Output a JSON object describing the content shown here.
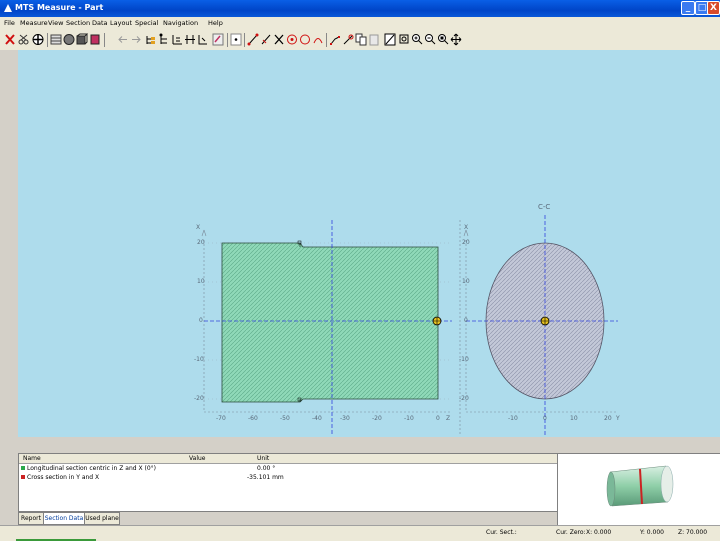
{
  "window": {
    "title": "MTS Measure - Part",
    "minimize_glyph": "_",
    "maximize_glyph": "□",
    "close_glyph": "X"
  },
  "menu": [
    "File",
    "Measure",
    "View",
    "Section",
    "Data",
    "Layout",
    "Special",
    "Navigation",
    "Help"
  ],
  "toolbar_icons": [
    "delete-icon",
    "scissors-icon",
    "target-icon",
    "frame-icon",
    "sphere-icon",
    "cube-icon",
    "cylinder-icon",
    "undo-icon",
    "redo-icon",
    "tree-icon",
    "hierarchy-icon",
    "axis-icon",
    "split-icon",
    "tree-down-icon",
    "wizard-icon",
    "dot-icon",
    "line-icon",
    "pen-icon",
    "cross-icon",
    "circle-dot-icon",
    "circle-icon",
    "circle-plus-icon",
    "arc-icon",
    "polyline-icon",
    "copy-icon",
    "paste-icon",
    "slash-icon",
    "zoom-fit-icon",
    "zoom-in-icon",
    "zoom-out-icon",
    "zoom-window-icon",
    "pan-icon"
  ],
  "long_view": {
    "x_axis_label": "X",
    "z_axis_label": "Z",
    "y_ticks": [
      "20",
      "10",
      "0",
      "-10",
      "-20"
    ],
    "x_ticks": [
      "-70",
      "-60",
      "-50",
      "-40",
      "-30",
      "-20",
      "-10",
      "0"
    ]
  },
  "cross_view": {
    "title": "C-C",
    "x_axis_label": "X",
    "y_axis_label": "Y",
    "y_ticks": [
      "20",
      "10",
      "0",
      "-10",
      "-20"
    ],
    "x_ticks": [
      "-10",
      "0",
      "10",
      "20"
    ]
  },
  "table": {
    "headers": {
      "name": "Name",
      "value": "Value",
      "unit": "Unit"
    },
    "rows": [
      {
        "name": "Longitudinal section centric in Z and X (0°)",
        "value": "0.00 °",
        "unit": "",
        "color": "#2aa84a"
      },
      {
        "name": "Cross section in Y and X",
        "value": "-35.101 mm",
        "unit": "",
        "color": "#cc2222"
      }
    ]
  },
  "tabs": [
    "Report",
    "Section Data",
    "Used plane"
  ],
  "active_tab": "Section Data",
  "status": {
    "cur_sect": "Cur. Sect.:",
    "cur_zero": "Cur. Zero:",
    "x": "X: 0.000",
    "y": "Y: 0.000",
    "z": "Z: 70.000"
  },
  "colors": {
    "canvas": "#aedcec",
    "long_fill": "#8fd9b8",
    "cross_fill": "#c3c8d8",
    "axis": "#3344dd"
  }
}
